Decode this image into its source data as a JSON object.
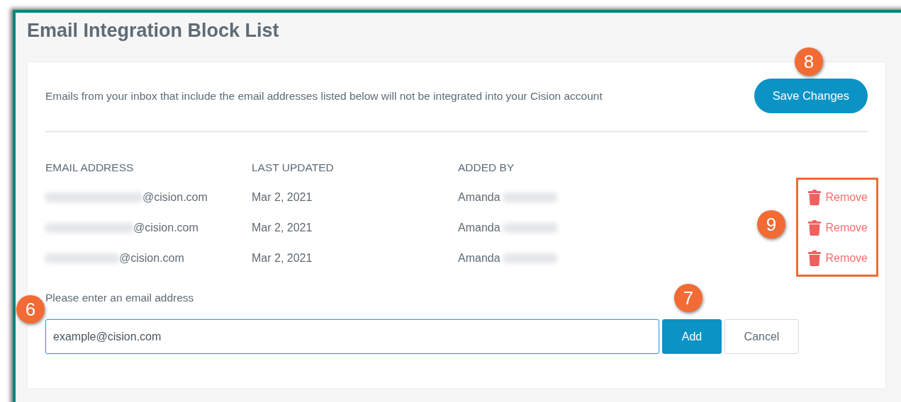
{
  "page": {
    "title": "Email Integration Block List"
  },
  "description": "Emails from your inbox that include the email addresses listed below will not be integrated into your Cision account",
  "save_button": {
    "label": "Save Changes"
  },
  "table": {
    "columns": [
      "EMAIL ADDRESS",
      "LAST UPDATED",
      "ADDED BY"
    ],
    "rows": [
      {
        "email": "@cision.com",
        "email_blurred": true,
        "last_updated": "Mar 2, 2021",
        "added_by": "Amanda",
        "added_by_blurred": true,
        "action": "Remove"
      },
      {
        "email": "@cision.com",
        "email_blurred": true,
        "last_updated": "Mar 2, 2021",
        "added_by": "Amanda",
        "added_by_blurred": true,
        "action": "Remove"
      },
      {
        "email": "@cision.com",
        "email_blurred": true,
        "last_updated": "Mar 2, 2021",
        "added_by": "Amanda",
        "added_by_blurred": true,
        "action": "Remove"
      }
    ]
  },
  "add_form": {
    "label": "Please enter an email address",
    "value": "example@cision.com",
    "buttons": [
      {
        "label": "Add",
        "kind": "primary"
      },
      {
        "label": "Cancel",
        "kind": "secondary"
      }
    ]
  },
  "callouts": [
    {
      "label": "8"
    },
    {
      "label": "9"
    },
    {
      "label": "7"
    },
    {
      "label": "6"
    }
  ]
}
